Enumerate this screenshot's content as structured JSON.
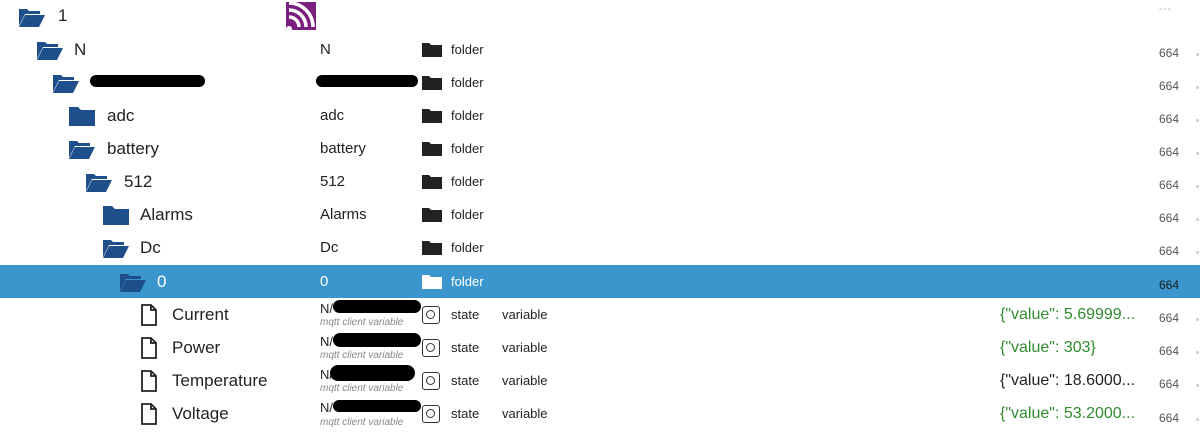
{
  "header": {
    "title": "1",
    "ellipsis": "---"
  },
  "colors": {
    "selected": "#3a96cc",
    "folder_blue": "#1f4f8a",
    "value_green": "#2e8b2e",
    "brand_purple": "#7b1f7e"
  },
  "rows": [
    {
      "name": "N",
      "col2": "N",
      "type": "folder",
      "acl": "664",
      "icon": "folder-open-icon"
    },
    {
      "name": "",
      "col2": "",
      "type": "folder",
      "acl": "664",
      "icon": "folder-open-icon"
    },
    {
      "name": "adc",
      "col2": "adc",
      "type": "folder",
      "acl": "664",
      "icon": "folder-closed-icon"
    },
    {
      "name": "battery",
      "col2": "battery",
      "type": "folder",
      "acl": "664",
      "icon": "folder-open-icon"
    },
    {
      "name": "512",
      "col2": "512",
      "type": "folder",
      "acl": "664",
      "icon": "folder-open-icon"
    },
    {
      "name": "Alarms",
      "col2": "Alarms",
      "type": "folder",
      "acl": "664",
      "icon": "folder-closed-icon"
    },
    {
      "name": "Dc",
      "col2": "Dc",
      "type": "folder",
      "acl": "664",
      "icon": "folder-open-icon"
    },
    {
      "name": "0",
      "col2": "0",
      "type": "folder",
      "acl": "664",
      "icon": "folder-open-icon"
    },
    {
      "name": "Current",
      "col2": "N/",
      "subtitle": "mqtt client variable",
      "type": "state",
      "role": "variable",
      "value": "{\"value\": 5.69999...",
      "acl": "664",
      "icon": "file-icon"
    },
    {
      "name": "Power",
      "col2": "N/",
      "subtitle": "mqtt client variable",
      "type": "state",
      "role": "variable",
      "value": "{\"value\": 303}",
      "acl": "664",
      "icon": "file-icon"
    },
    {
      "name": "Temperature",
      "col2": "N/",
      "subtitle": "mqtt client variable",
      "type": "state",
      "role": "variable",
      "value": "{\"value\": 18.6000...",
      "acl": "664",
      "icon": "file-icon"
    },
    {
      "name": "Voltage",
      "col2": "N/",
      "subtitle": "mqtt client variable",
      "type": "state",
      "role": "variable",
      "value": "{\"value\": 53.2000...",
      "acl": "664",
      "icon": "file-icon"
    }
  ]
}
